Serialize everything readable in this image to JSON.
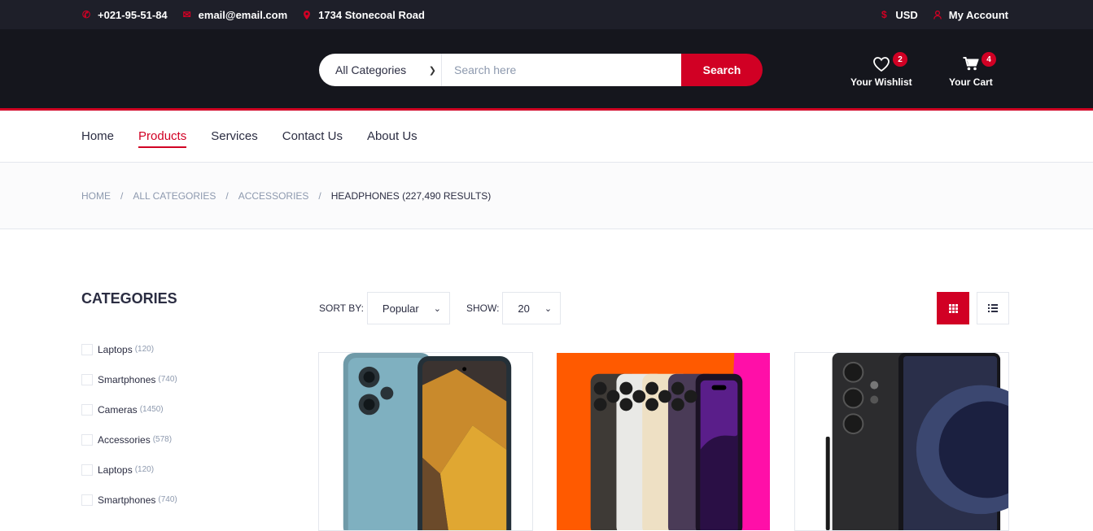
{
  "topbar": {
    "phone": "+021-95-51-84",
    "email": "email@email.com",
    "address": "1734 Stonecoal Road",
    "currency": "USD",
    "account": "My Account"
  },
  "header": {
    "category_select": "All Categories",
    "search_placeholder": "Search here",
    "search_button": "Search",
    "wishlist_label": "Your Wishlist",
    "wishlist_count": "2",
    "cart_label": "Your Cart",
    "cart_count": "4"
  },
  "nav": {
    "items": [
      "Home",
      "Products",
      "Services",
      "Contact Us",
      "About Us"
    ],
    "active": "Products"
  },
  "breadcrumb": {
    "items": [
      "Home",
      "All Categories",
      "Accessories"
    ],
    "current": "Headphones (227,490 Results)"
  },
  "sidebar": {
    "title": "Categories",
    "categories": [
      {
        "label": "Laptops",
        "count": "(120)"
      },
      {
        "label": "Smartphones",
        "count": "(740)"
      },
      {
        "label": "Cameras",
        "count": "(1450)"
      },
      {
        "label": "Accessories",
        "count": "(578)"
      },
      {
        "label": "Laptops",
        "count": "(120)"
      },
      {
        "label": "Smartphones",
        "count": "(740)"
      }
    ]
  },
  "store_filter": {
    "sort_label": "SORT BY:",
    "sort_value": "Popular",
    "show_label": "SHOW:",
    "show_value": "20"
  },
  "colors": {
    "accent": "#d10024",
    "topbar_bg": "#1e1f29",
    "header_bg": "#15161d"
  },
  "icons": [
    "phone-icon",
    "envelope-icon",
    "map-marker-icon",
    "dollar-icon",
    "user-icon",
    "heart-icon",
    "cart-icon",
    "grid-view-icon",
    "list-view-icon"
  ]
}
